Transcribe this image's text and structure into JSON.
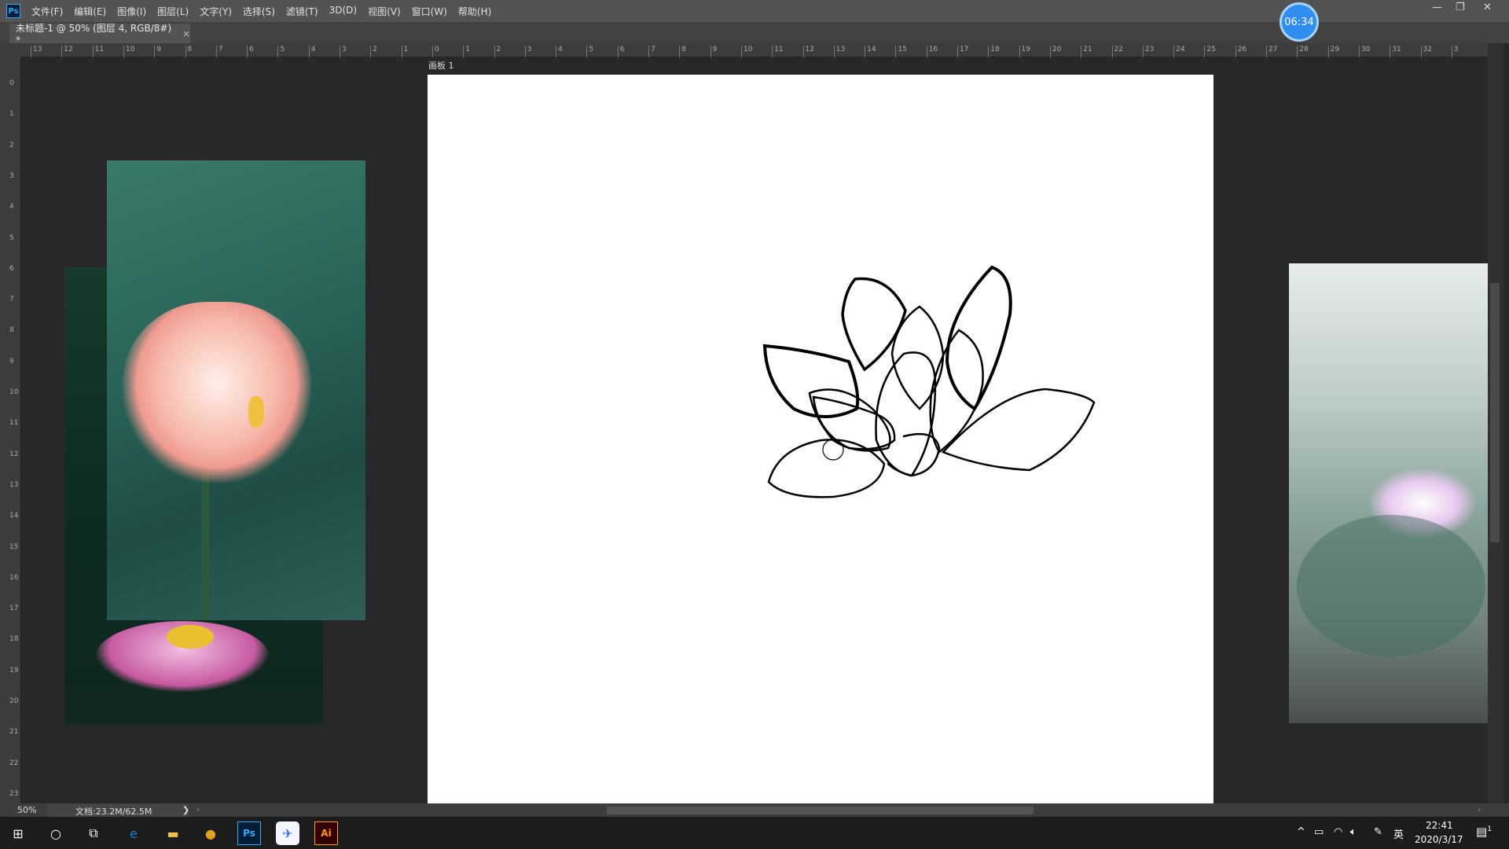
{
  "app": {
    "logo": "Ps",
    "menu": [
      "文件(F)",
      "编辑(E)",
      "图像(I)",
      "图层(L)",
      "文字(Y)",
      "选择(S)",
      "滤镜(T)",
      "3D(D)",
      "视图(V)",
      "窗口(W)",
      "帮助(H)"
    ]
  },
  "tab": {
    "title": "未标题-1 @ 50% (图层 4, RGB/8#) *",
    "close": "×"
  },
  "rulers": {
    "top": [
      "13",
      "12",
      "11",
      "10",
      "9",
      "8",
      "7",
      "6",
      "5",
      "4",
      "3",
      "2",
      "1",
      "0",
      "1",
      "2",
      "3",
      "4",
      "5",
      "6",
      "7",
      "8",
      "9",
      "10",
      "11",
      "12",
      "13",
      "14",
      "15",
      "16",
      "17",
      "18",
      "19",
      "20",
      "21",
      "22",
      "23",
      "24",
      "25",
      "26",
      "27",
      "28",
      "29",
      "30",
      "31",
      "32",
      "3"
    ],
    "left": [
      "0",
      "1",
      "2",
      "3",
      "4",
      "5",
      "6",
      "7",
      "8",
      "9",
      "10",
      "11",
      "12",
      "13",
      "14",
      "15",
      "16",
      "17",
      "18",
      "19",
      "20",
      "21",
      "22",
      "23"
    ]
  },
  "artboard": {
    "label": "画板 1"
  },
  "timer": "06:34",
  "status": {
    "zoom": "50%",
    "doc": "文档:23.2M/62.5M",
    "arrow": "❯",
    "left": "‹",
    "right": "›"
  },
  "taskbar": {
    "apps": [
      {
        "name": "windows-start-icon",
        "glyph": "⊞"
      },
      {
        "name": "search-circle-icon",
        "glyph": "○"
      },
      {
        "name": "task-view-icon",
        "glyph": "⧉"
      },
      {
        "name": "edge-icon",
        "glyph": "e"
      },
      {
        "name": "file-explorer-icon",
        "glyph": "▬"
      },
      {
        "name": "chrome-icon",
        "glyph": "●"
      },
      {
        "name": "photoshop-icon",
        "glyph": "Ps"
      },
      {
        "name": "feishu-icon",
        "glyph": "✈"
      },
      {
        "name": "illustrator-icon",
        "glyph": "Ai"
      }
    ],
    "tray": {
      "chevron": "^",
      "ime": "英",
      "time": "22:41",
      "date": "2020/3/17",
      "notifications": "1"
    }
  },
  "colors": {
    "accent": "#31a8ff",
    "illustrator": "#ff9a00",
    "timer": "#2f8ef0"
  }
}
